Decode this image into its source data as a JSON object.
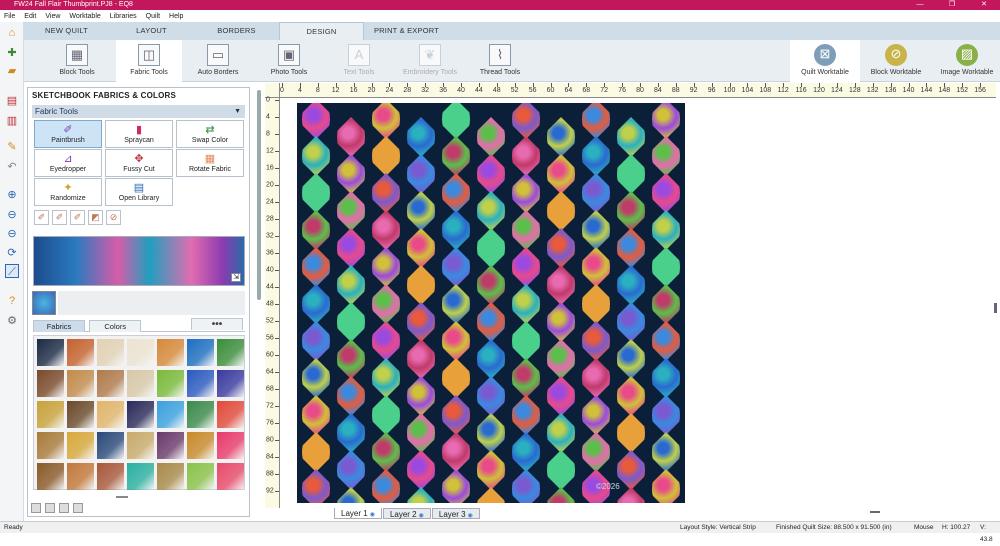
{
  "window": {
    "title": "FW24 Fall Flair Thumbprint.PJ8 - EQ8",
    "controls": [
      "—",
      "❐",
      "✕"
    ]
  },
  "menu": [
    "File",
    "Edit",
    "View",
    "Worktable",
    "Libraries",
    "Quilt",
    "Help"
  ],
  "tabs": [
    {
      "label": "NEW QUILT",
      "active": false
    },
    {
      "label": "LAYOUT",
      "active": false
    },
    {
      "label": "BORDERS",
      "active": false
    },
    {
      "label": "DESIGN",
      "active": true
    },
    {
      "label": "PRINT & EXPORT",
      "active": false
    }
  ],
  "ribbon": {
    "block_tools": "Block Tools",
    "fabric_tools": "Fabric Tools",
    "auto_borders": "Auto Borders",
    "photo_tools": "Photo Tools",
    "text_tools": "Text Tools",
    "embroidery_tools": "Embroidery Tools",
    "thread_tools": "Thread Tools",
    "quilt_worktable": "Quilt Worktable",
    "block_worktable": "Block Worktable",
    "image_worktable": "Image Worktable"
  },
  "panel": {
    "title": "SKETCHBOOK FABRICS & COLORS",
    "section": "Fabric Tools",
    "tools": [
      "Paintbrush",
      "Spraycan",
      "Swap Color",
      "Eyedropper",
      "Fussy Cut",
      "Rotate Fabric",
      "Randomize",
      "Open Library"
    ],
    "subtabs": [
      "Fabrics",
      "Colors"
    ],
    "more": "•••"
  },
  "fabric_swatches": [
    "#1b2a44",
    "#c4622e",
    "#e2d2b4",
    "#ece4d2",
    "#d6893a",
    "#1d6fc0",
    "#3a8e3a",
    "#7a4a2a",
    "#c28a4a",
    "#b07a4a",
    "#d8c8a8",
    "#7aba3a",
    "#2a5ac0",
    "#3a3aa0",
    "#c8a23a",
    "#6a4a2a",
    "#e2b46a",
    "#2a2a5a",
    "#3aa0e0",
    "#3a8a4a",
    "#e24a3a",
    "#a87a3a",
    "#d8a83a",
    "#2a4a7a",
    "#c8aa6a",
    "#6a3a6a",
    "#c88a2a",
    "#e83a6a",
    "#8a5a2a",
    "#c2783a",
    "#a8583a",
    "#2ab0a0",
    "#a88a4a",
    "#8ac24a",
    "#e84a6a"
  ],
  "ruler_top": [
    "0",
    "4",
    "8",
    "12",
    "16",
    "20",
    "24",
    "28",
    "32",
    "36",
    "40",
    "44",
    "48",
    "52",
    "56",
    "60",
    "64",
    "68",
    "72",
    "76",
    "80",
    "84",
    "88",
    "92",
    "96",
    "100",
    "104",
    "108",
    "112",
    "116",
    "120",
    "124",
    "128",
    "132",
    "136",
    "140",
    "144",
    "148",
    "152",
    "156"
  ],
  "ruler_left": [
    "0",
    "4",
    "8",
    "12",
    "16",
    "20",
    "24",
    "28",
    "32",
    "36",
    "40",
    "44",
    "48",
    "52",
    "56",
    "60",
    "64",
    "68",
    "72",
    "76",
    "80",
    "84",
    "88",
    "92"
  ],
  "watermark": "©2026",
  "layers": [
    "Layer 1",
    "Layer 2",
    "Layer 3"
  ],
  "status": {
    "ready": "Ready",
    "layout": "Layout Style: Vertical Strip",
    "size": "Finished Quilt Size: 88.500 x 91.500 (in)",
    "mouse": "Mouse",
    "h": "H: 100.27",
    "v": "V: 43.8"
  },
  "colors": {
    "titlebar": "#c2185b",
    "quilt_background": "#0b2038",
    "tab_bar": "#cfdde8"
  }
}
